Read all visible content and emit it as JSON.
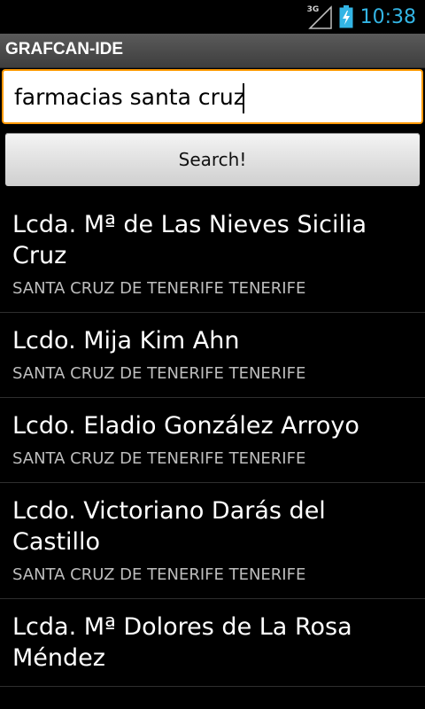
{
  "status_bar": {
    "network_type": "3G",
    "time": "10:38"
  },
  "app": {
    "title": "GRAFCAN-IDE"
  },
  "search": {
    "value": "farmacias santa cruz",
    "button_label": "Search!"
  },
  "results": [
    {
      "name": "Lcda. Mª de Las Nieves Sicilia Cruz",
      "location": "SANTA CRUZ DE TENERIFE TENERIFE"
    },
    {
      "name": "Lcdo. Mija Kim Ahn",
      "location": "SANTA CRUZ DE TENERIFE TENERIFE"
    },
    {
      "name": "Lcdo. Eladio González Arroyo",
      "location": "SANTA CRUZ DE TENERIFE TENERIFE"
    },
    {
      "name": "Lcdo. Victoriano Darás del Castillo",
      "location": "SANTA CRUZ DE TENERIFE TENERIFE"
    },
    {
      "name": "Lcda. Mª Dolores de La Rosa Méndez",
      "location": ""
    }
  ],
  "colors": {
    "accent": "#33b5e5",
    "focus_border": "#ff9900"
  },
  "icons": {
    "signal": "signal-icon",
    "battery": "battery-charging-icon"
  }
}
